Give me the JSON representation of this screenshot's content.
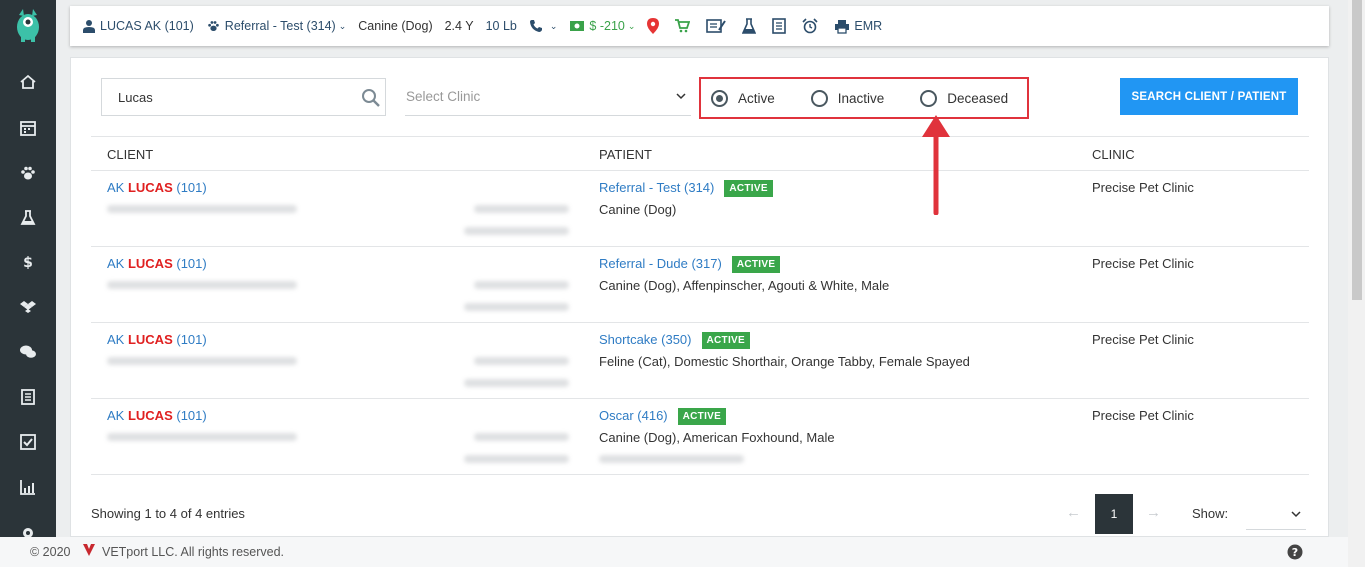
{
  "header": {
    "client": "LUCAS AK (101)",
    "patient": "Referral - Test (314)",
    "species": "Canine (Dog)",
    "age": "2.4 Y",
    "weight": "10 Lb",
    "balance": "$ -210",
    "emr": "EMR"
  },
  "search": {
    "value": "Lucas",
    "clinic_placeholder": "Select Clinic",
    "status_options": [
      "Active",
      "Inactive",
      "Deceased"
    ],
    "selected_status": "Active",
    "button_label": "SEARCH CLIENT / PATIENT"
  },
  "table": {
    "columns": [
      "CLIENT",
      "PATIENT",
      "CLINIC"
    ],
    "rows": [
      {
        "client_first": "AK",
        "client_last": "LUCAS",
        "client_id": "(101)",
        "patient": "Referral - Test (314)",
        "status": "ACTIVE",
        "patient_detail": "Canine (Dog)",
        "clinic": "Precise Pet Clinic"
      },
      {
        "client_first": "AK",
        "client_last": "LUCAS",
        "client_id": "(101)",
        "patient": "Referral - Dude (317)",
        "status": "ACTIVE",
        "patient_detail": "Canine (Dog), Affenpinscher, Agouti & White, Male",
        "clinic": "Precise Pet Clinic"
      },
      {
        "client_first": "AK",
        "client_last": "LUCAS",
        "client_id": "(101)",
        "patient": "Shortcake (350)",
        "status": "ACTIVE",
        "patient_detail": "Feline (Cat), Domestic Shorthair, Orange Tabby, Female Spayed",
        "clinic": "Precise Pet Clinic"
      },
      {
        "client_first": "AK",
        "client_last": "LUCAS",
        "client_id": "(101)",
        "patient": "Oscar (416)",
        "status": "ACTIVE",
        "patient_detail": "Canine (Dog), American Foxhound, Male",
        "clinic": "Precise Pet Clinic"
      }
    ]
  },
  "pagination": {
    "summary": "Showing 1 to 4 of 4 entries",
    "prev": "←",
    "current_page": "1",
    "next": "→",
    "show_label": "Show:"
  },
  "footer": {
    "copyright": "© 2020",
    "brand": "VETport LLC. All rights reserved."
  },
  "colors": {
    "accent": "#2196f3",
    "sidebar": "#2b3439",
    "badge": "#3aa64a",
    "highlight_box": "#e0333c",
    "link": "#2f7cc4"
  },
  "icons": [
    "home-icon",
    "calendar-icon",
    "paw-icon",
    "flask-icon",
    "dollar-icon",
    "dropbox-icon",
    "chat-icon",
    "list-icon",
    "checkbox-icon",
    "chart-icon",
    "gear-icon",
    "search-icon",
    "help-icon"
  ]
}
